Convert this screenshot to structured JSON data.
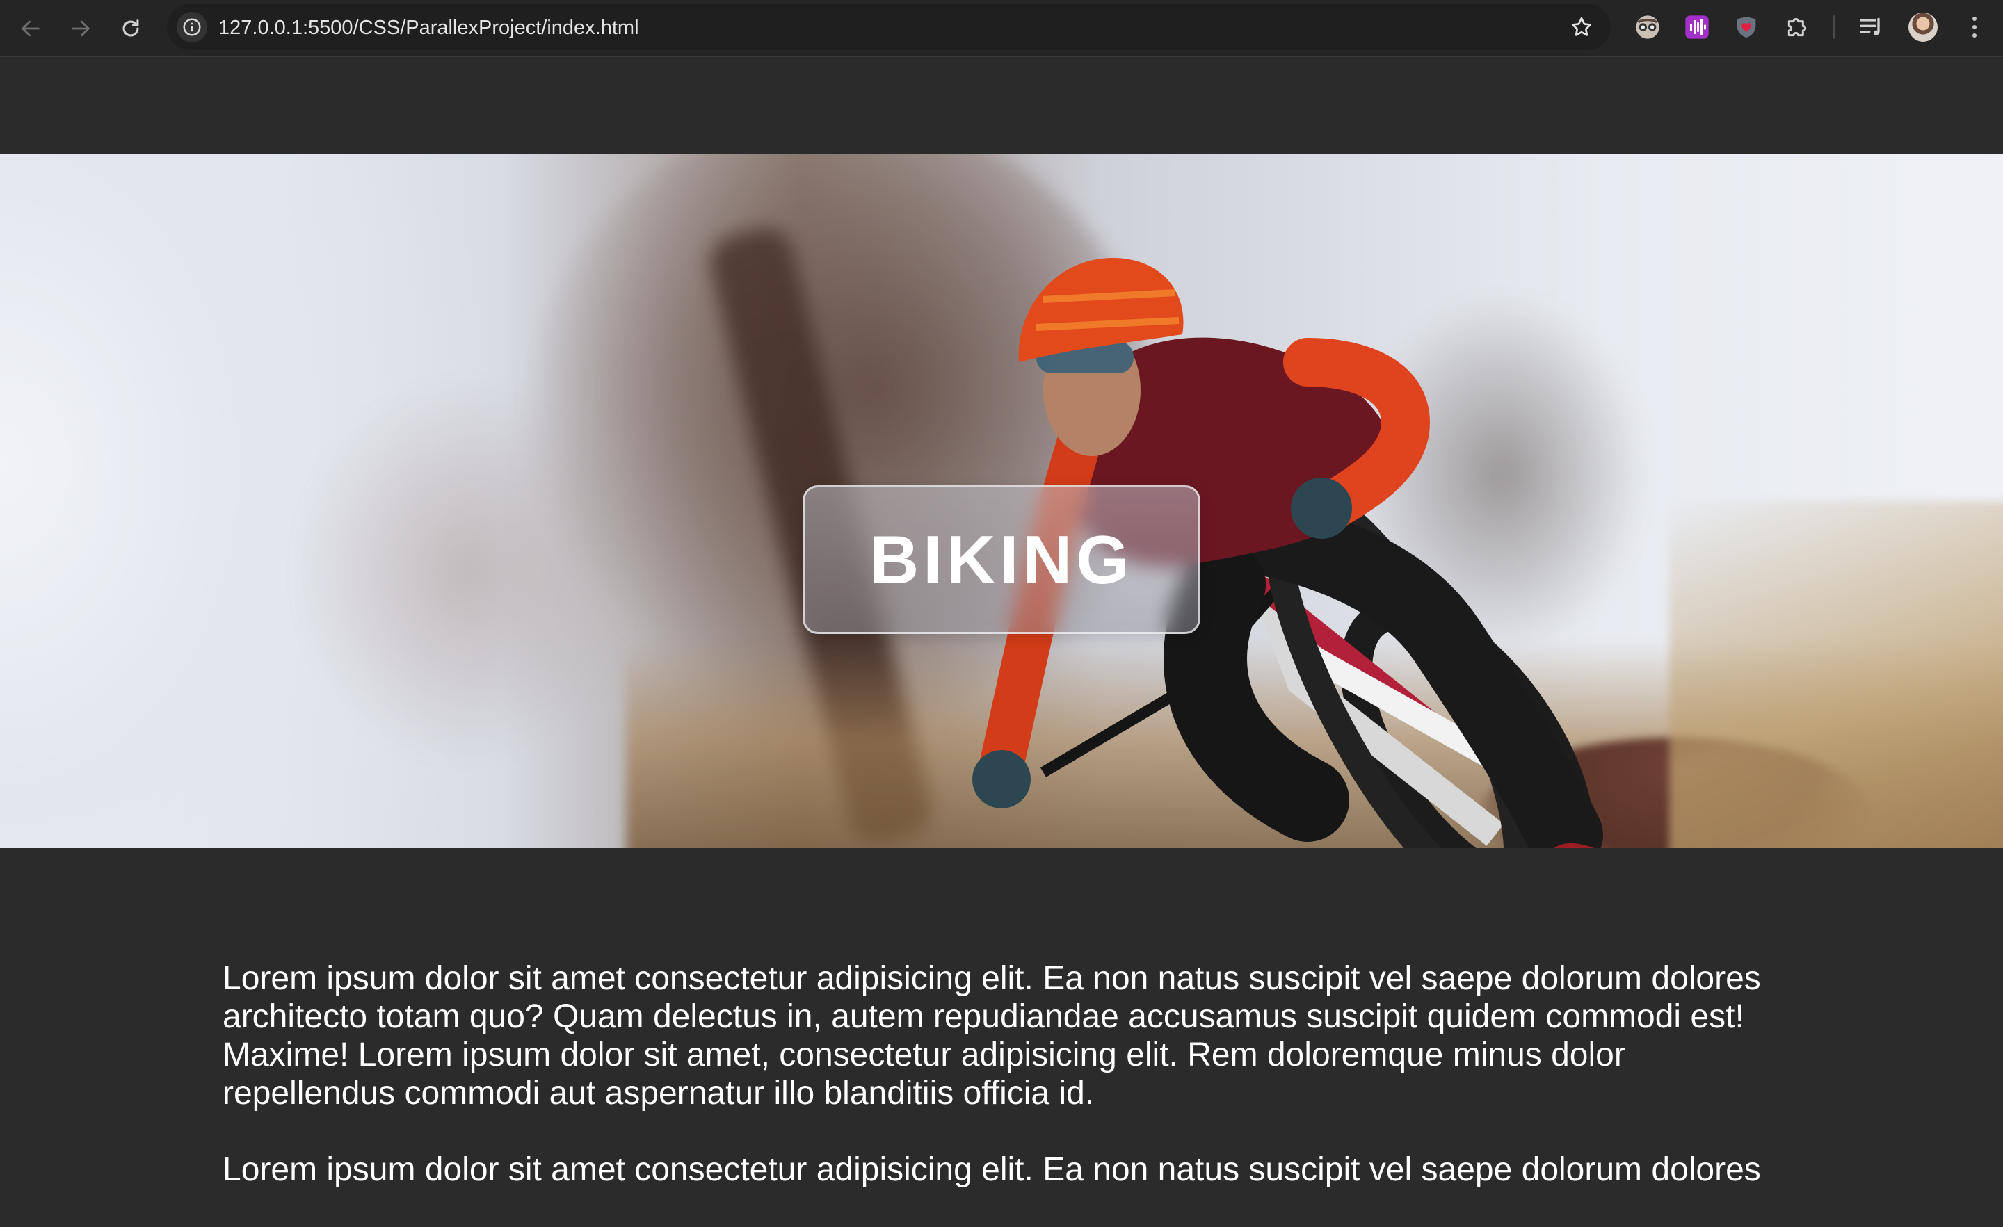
{
  "browser": {
    "url": "127.0.0.1:5500/CSS/ParallexProject/index.html",
    "toolbar_icons": [
      "back-arrow-icon",
      "forward-arrow-icon",
      "reload-icon",
      "site-info-icon",
      "bookmark-star-icon"
    ],
    "extension_icons": [
      "spy-glasses-extension-icon",
      "audio-waveform-extension-icon",
      "shield-heart-extension-icon",
      "puzzle-piece-icon",
      "reading-list-icon"
    ]
  },
  "hero": {
    "title": "BIKING",
    "image_subject": "mountain-biker-photo"
  },
  "article": {
    "paragraphs": [
      "Lorem ipsum dolor sit amet consectetur adipisicing elit. Ea non natus suscipit vel saepe dolorum dolores architecto totam quo? Quam delectus in, autem repudiandae accusamus suscipit quidem commodi est! Maxime! Lorem ipsum dolor sit amet, consectetur adipisicing elit. Rem doloremque minus dolor repellendus commodi aut aspernatur illo blanditiis officia id.",
      "Lorem ipsum dolor sit amet consectetur adipisicing elit. Ea non natus suscipit vel saepe dolorum dolores"
    ]
  },
  "colors": {
    "page_background": "#2b2b2b",
    "chrome_background": "#252525",
    "omnibox_background": "#1f1f1f",
    "text": "#ffffff"
  }
}
